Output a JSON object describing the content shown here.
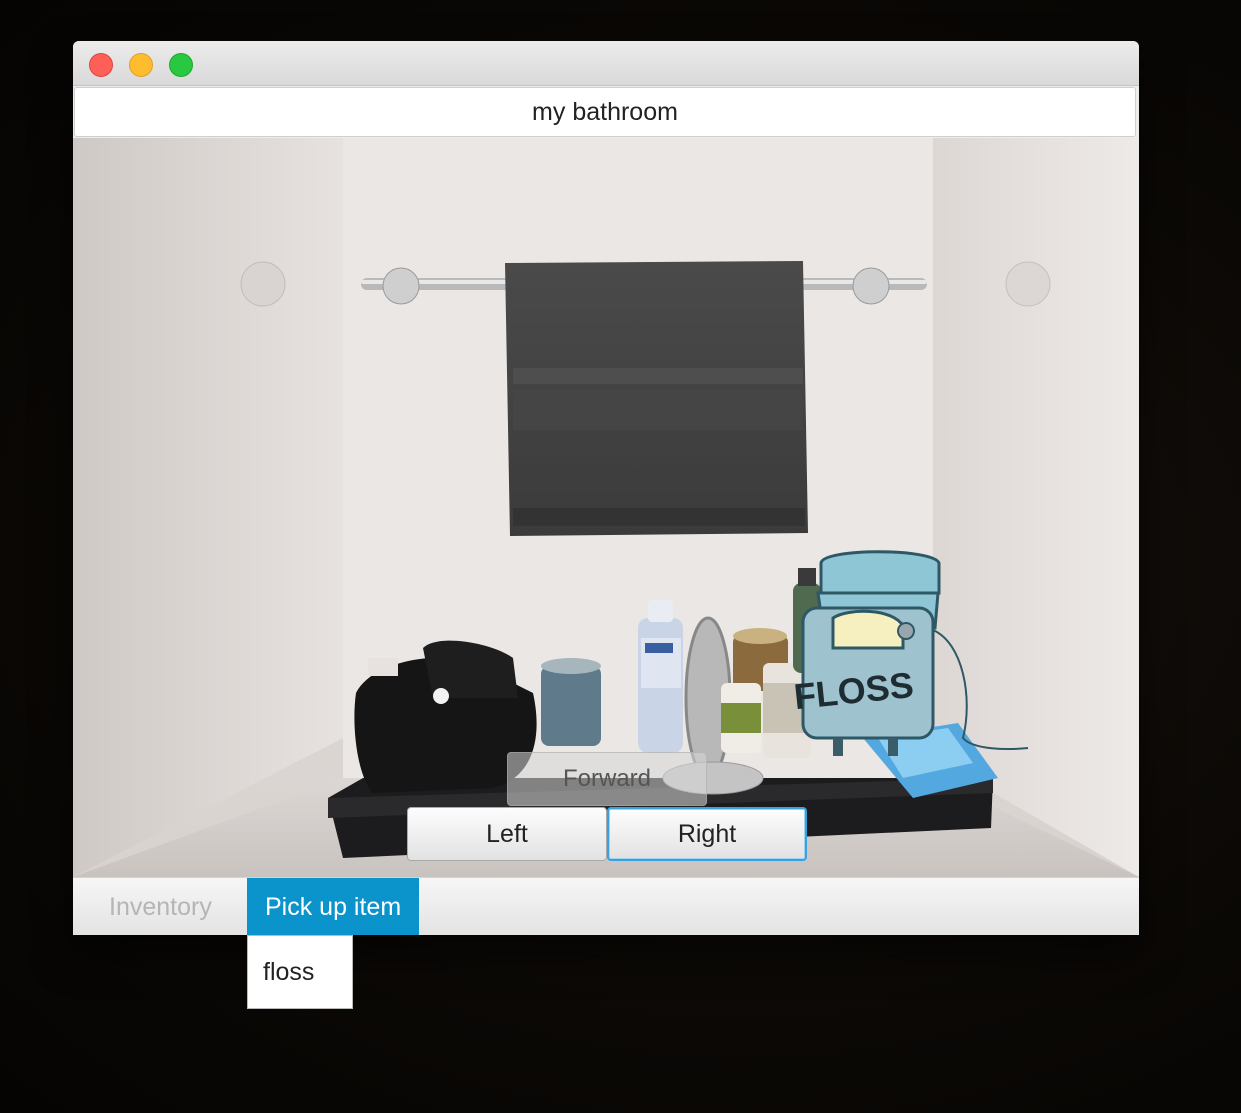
{
  "window": {
    "room_title": "my bathroom"
  },
  "scene": {
    "floss_label": "FLOSS"
  },
  "navigation": {
    "forward_label": "Forward",
    "left_label": "Left",
    "right_label": "Right"
  },
  "tabs": [
    {
      "label": "Inventory",
      "active": false
    },
    {
      "label": "Pick up item",
      "active": true
    }
  ],
  "pickup_menu": {
    "items": [
      "floss"
    ]
  },
  "colors": {
    "tab_active": "#0b93cc",
    "focus_ring": "#3aa0e0"
  }
}
